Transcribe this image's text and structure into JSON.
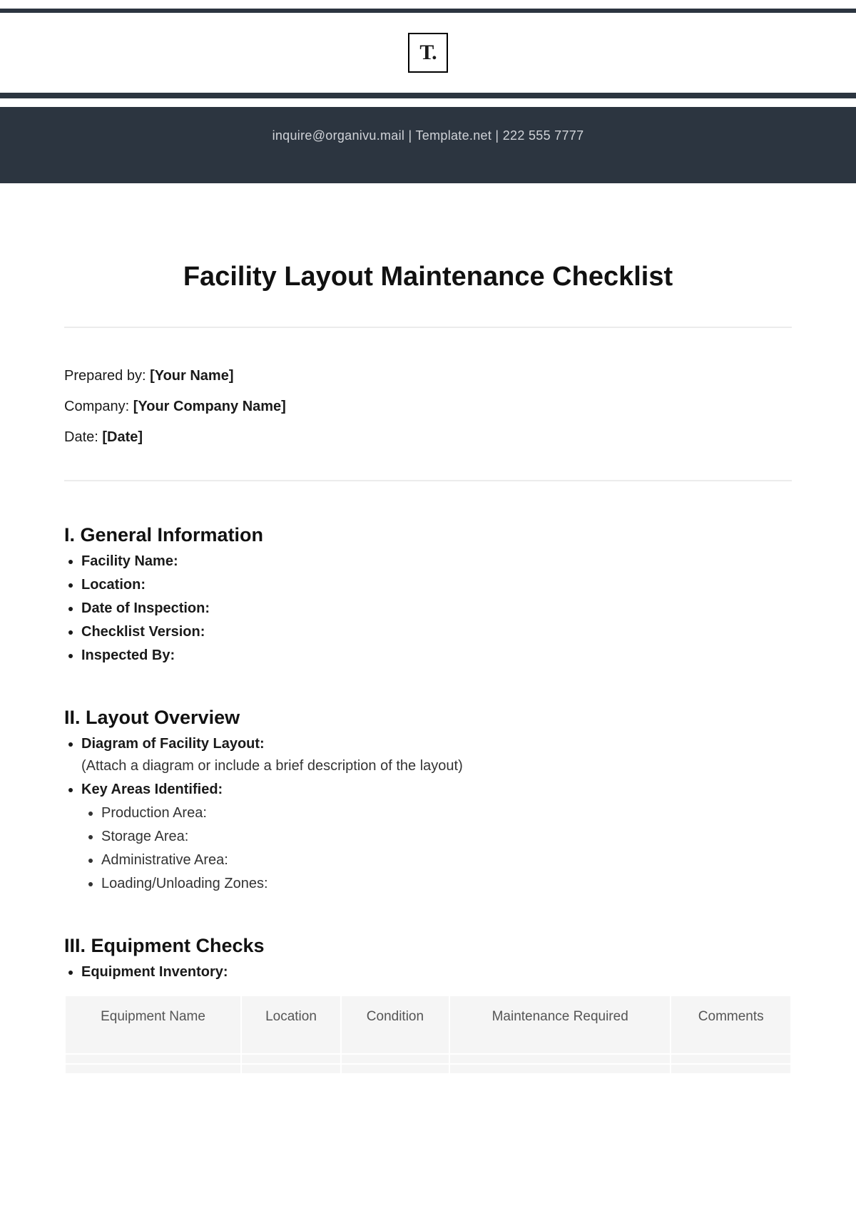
{
  "logo_text": "T.",
  "contact_bar": "inquire@organivu.mail  |  Template.net  |  222 555 7777",
  "title": "Facility Layout Maintenance Checklist",
  "meta": {
    "prepared_by_label": "Prepared by: ",
    "prepared_by_value": "[Your Name]",
    "company_label": "Company: ",
    "company_value": "[Your Company Name]",
    "date_label": "Date: ",
    "date_value": "[Date]"
  },
  "sections": {
    "s1": {
      "heading": "I. General Information",
      "items": [
        "Facility Name:",
        "Location:",
        "Date of Inspection:",
        "Checklist Version:",
        "Inspected By:"
      ]
    },
    "s2": {
      "heading": "II. Layout Overview",
      "item1_label": "Diagram of Facility Layout:",
      "item1_note": "(Attach a diagram or include a brief description of the layout)",
      "item2_label": "Key Areas Identified:",
      "item2_subs": [
        "Production Area:",
        "Storage Area:",
        "Administrative Area:",
        "Loading/Unloading Zones:"
      ]
    },
    "s3": {
      "heading": "III. Equipment Checks",
      "item1_label": "Equipment Inventory:",
      "table_headers": [
        "Equipment Name",
        "Location",
        "Condition",
        "Maintenance Required",
        "Comments"
      ]
    }
  }
}
